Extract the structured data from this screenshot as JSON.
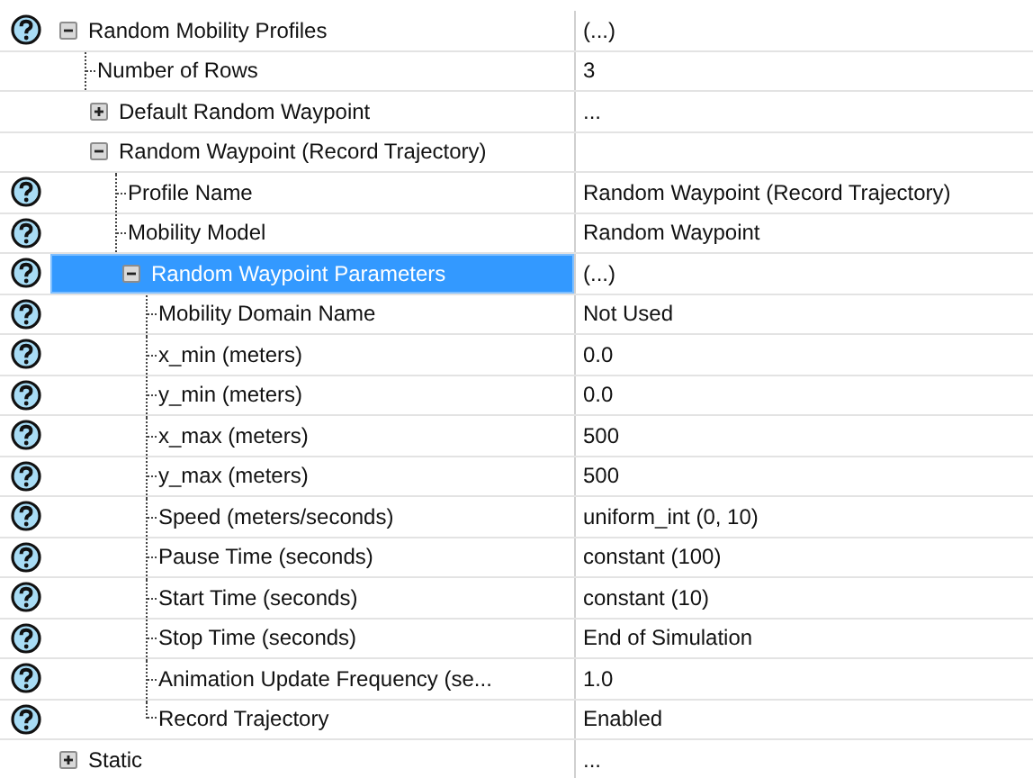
{
  "properties": [
    {
      "label": "Random Mobility Profiles",
      "value": "(...)",
      "help": true,
      "expanded": true,
      "selected": false,
      "children": [
        {
          "label": "Number of Rows",
          "value": "3",
          "help": false,
          "selected": false
        },
        {
          "label": "Default Random Waypoint",
          "value": "...",
          "help": false,
          "expanded": false,
          "selected": false
        },
        {
          "label": "Random Waypoint (Record Trajectory)",
          "help": false,
          "expanded": true,
          "selected": false,
          "children": [
            {
              "label": "Profile Name",
              "value": "Random Waypoint (Record Trajectory)",
              "help": true,
              "selected": false
            },
            {
              "label": "Mobility Model",
              "value": "Random Waypoint",
              "help": true,
              "selected": false
            },
            {
              "label": "Random Waypoint Parameters",
              "value": "(...)",
              "help": true,
              "expanded": true,
              "selected": true,
              "children": [
                {
                  "label": "Mobility Domain Name",
                  "value": "Not Used",
                  "help": true,
                  "selected": false
                },
                {
                  "label": "x_min (meters)",
                  "value": "0.0",
                  "help": true,
                  "selected": false
                },
                {
                  "label": "y_min (meters)",
                  "value": "0.0",
                  "help": true,
                  "selected": false
                },
                {
                  "label": "x_max (meters)",
                  "value": "500",
                  "help": true,
                  "selected": false
                },
                {
                  "label": "y_max (meters)",
                  "value": "500",
                  "help": true,
                  "selected": false
                },
                {
                  "label": "Speed (meters/seconds)",
                  "value": "uniform_int (0, 10)",
                  "help": true,
                  "selected": false
                },
                {
                  "label": "Pause Time (seconds)",
                  "value": "constant (100)",
                  "help": true,
                  "selected": false
                },
                {
                  "label": "Start Time (seconds)",
                  "value": "constant (10)",
                  "help": true,
                  "selected": false
                },
                {
                  "label": "Stop Time (seconds)",
                  "value": "End of Simulation",
                  "help": true,
                  "selected": false
                },
                {
                  "label": "Animation Update Frequency (se...",
                  "value": "1.0",
                  "help": true,
                  "selected": false
                },
                {
                  "label": "Record Trajectory",
                  "value": "Enabled",
                  "help": true,
                  "selected": false
                }
              ]
            }
          ]
        }
      ]
    },
    {
      "label": "Static",
      "value": "...",
      "help": false,
      "expanded": false,
      "selected": false
    }
  ]
}
